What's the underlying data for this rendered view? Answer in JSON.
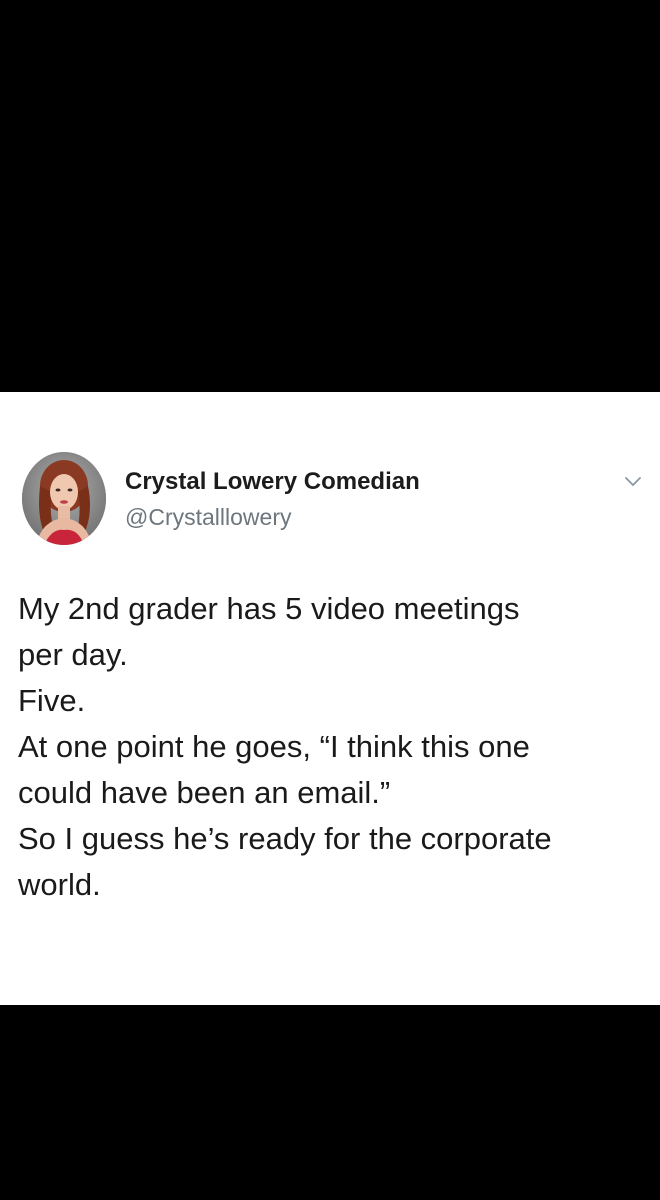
{
  "tweet": {
    "author": {
      "name": "Crystal Lowery Comedian",
      "handle": "@Crystalllowery",
      "avatar_icon": "profile-photo"
    },
    "menu_icon": "chevron-down-icon",
    "text_lines": [
      "My 2nd grader has 5 video meetings",
      "per day.",
      "Five.",
      "At one point he goes, “I think this one",
      "could have been an email.”",
      "So I guess he’s ready for the corporate",
      "world."
    ]
  },
  "colors": {
    "background": "#000000",
    "card": "#ffffff",
    "name_text": "#1c1c1c",
    "handle_text": "#6e767d",
    "body_text": "#1a1a1a",
    "chevron": "#8899a6"
  }
}
